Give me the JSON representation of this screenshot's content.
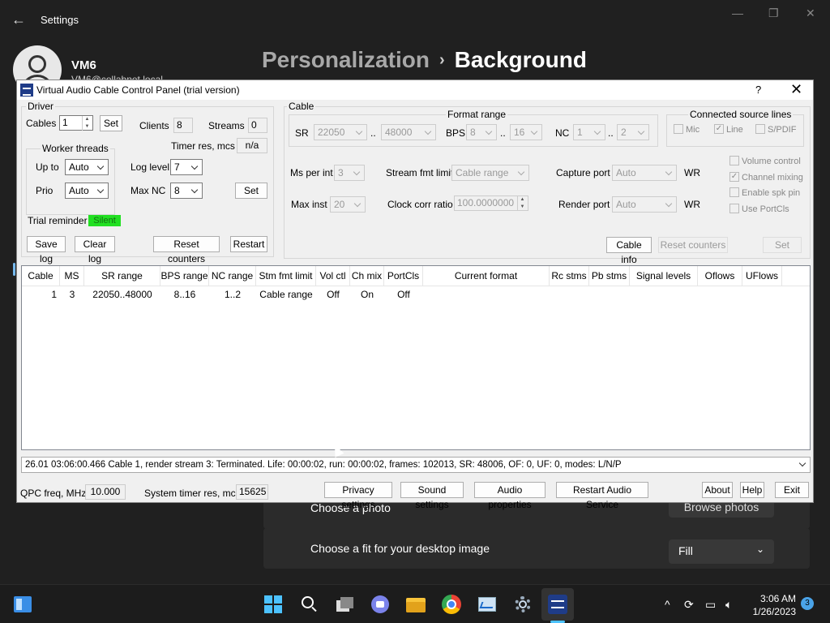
{
  "settings": {
    "window_title": "Settings",
    "user_name": "VM6",
    "user_email": "VM6@collabnet.local",
    "breadcrumb_parent": "Personalization",
    "breadcrumb_current": "Background",
    "choose_photo_label": "Choose a photo",
    "browse_photos_label": "Browse photos",
    "fit_label": "Choose a fit for your desktop image",
    "fit_value": "Fill"
  },
  "vac": {
    "title": "Virtual Audio Cable Control Panel (trial version)",
    "help": "?",
    "close": "✕",
    "driver": {
      "group_label": "Driver",
      "cables_label": "Cables",
      "cables_value": "1",
      "set_label": "Set",
      "clients_label": "Clients",
      "clients_value": "8",
      "streams_label": "Streams",
      "streams_value": "0",
      "timer_res_label": "Timer res, mcs",
      "timer_res_value": "n/a",
      "worker_threads_label": "Worker threads",
      "up_to_label": "Up to",
      "up_to_value": "Auto",
      "prio_label": "Prio",
      "prio_value": "Auto",
      "log_level_label": "Log level",
      "log_level_value": "7",
      "max_nc_label": "Max NC",
      "max_nc_value": "8",
      "set2_label": "Set",
      "trial_reminder_label": "Trial reminder",
      "trial_reminder_value": "Silent",
      "save_log": "Save log",
      "clear_log": "Clear log",
      "reset_counters": "Reset counters",
      "restart": "Restart"
    },
    "cable": {
      "group_label": "Cable",
      "format_range_label": "Format range",
      "sr_label": "SR",
      "sr_min": "22050",
      "sr_max": "48000",
      "dots": "..",
      "bps_label": "BPS",
      "bps_min": "8",
      "bps_max": "16",
      "nc_label": "NC",
      "nc_min": "1",
      "nc_max": "2",
      "connected_label": "Connected source lines",
      "mic_label": "Mic",
      "line_label": "Line",
      "spdif_label": "S/PDIF",
      "ms_per_int_label": "Ms per int",
      "ms_per_int_value": "3",
      "stream_fmt_label": "Stream fmt limit",
      "stream_fmt_value": "Cable range",
      "capture_port_label": "Capture port",
      "capture_port_value": "Auto",
      "wr1": "WR",
      "max_inst_label": "Max inst",
      "max_inst_value": "20",
      "clock_corr_label": "Clock corr ratio",
      "clock_corr_value": "100.0000000",
      "render_port_label": "Render port",
      "render_port_value": "Auto",
      "wr2": "WR",
      "volume_control": "Volume control",
      "channel_mixing": "Channel mixing",
      "enable_spk_pin": "Enable spk pin",
      "use_portcls": "Use PortCls",
      "cable_info": "Cable info",
      "reset_counters": "Reset counters",
      "set": "Set"
    },
    "table": {
      "headers": [
        "Cable",
        "MS",
        "SR range",
        "BPS range",
        "NC range",
        "Stm fmt limit",
        "Vol ctl",
        "Ch mix",
        "PortCls",
        "Current format",
        "Rc stms",
        "Pb stms",
        "Signal levels",
        "Oflows",
        "UFlows"
      ],
      "rows": [
        [
          "1",
          "3",
          "22050..48000",
          "8..16",
          "1..2",
          "Cable range",
          "Off",
          "On",
          "Off"
        ]
      ]
    },
    "status_text": "26.01  03:06:00.466  Cable 1, render stream 3: Terminated. Life: 00:00:02, run: 00:00:02, frames: 102013, SR: 48006, OF: 0, UF: 0, modes: L/N/P",
    "qpc_label": "QPC freq, MHz",
    "qpc_value": "10.000",
    "systimer_label": "System timer res, mcs",
    "systimer_value": "15625",
    "privacy_settings": "Privacy settings",
    "sound_settings": "Sound settings",
    "audio_properties": "Audio properties",
    "restart_audio": "Restart Audio Service",
    "about": "About",
    "help_btn": "Help",
    "exit": "Exit"
  },
  "taskbar": {
    "time": "3:06 AM",
    "date": "1/26/2023",
    "notifications": "3"
  }
}
